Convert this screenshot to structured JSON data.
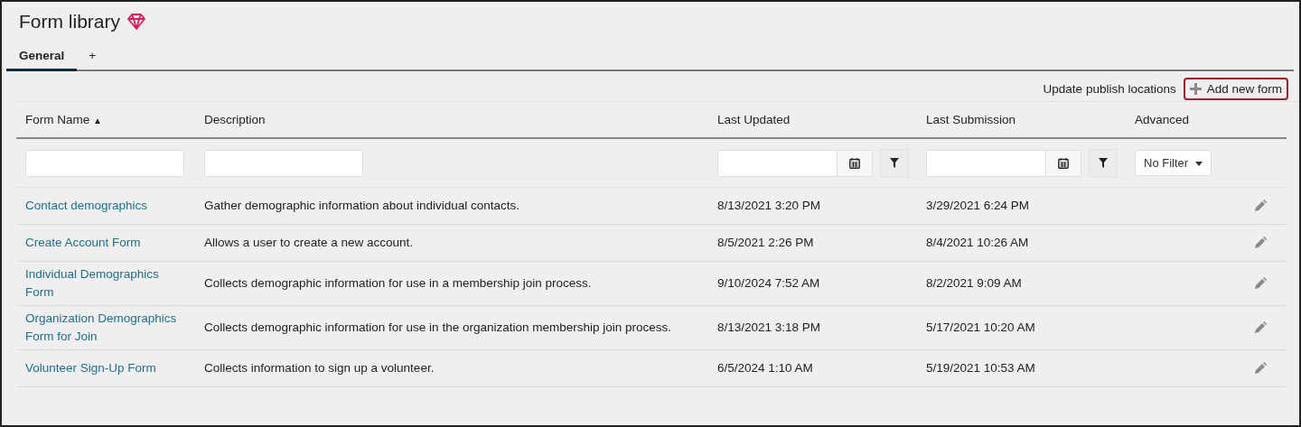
{
  "title": "Form library",
  "tabs": [
    {
      "label": "General",
      "selected": true
    },
    {
      "label": "+",
      "selected": false
    }
  ],
  "actions": {
    "link": "Update publish locations",
    "button": "Add new form"
  },
  "table": {
    "columns": [
      {
        "label": "Form Name",
        "sort": "▲"
      },
      {
        "label": "Description"
      },
      {
        "label": "Last Updated"
      },
      {
        "label": "Last Submission"
      },
      {
        "label": "Advanced"
      }
    ],
    "filters": {
      "advanced": "No Filter"
    },
    "rows": [
      {
        "name": "Contact demographics",
        "description": "Gather demographic information about individual contacts.",
        "last_updated": "8/13/2021 3:20 PM",
        "last_submission": "3/29/2021 6:24 PM"
      },
      {
        "name": "Create Account Form",
        "description": "Allows a user to create a new account.",
        "last_updated": "8/5/2021 2:26 PM",
        "last_submission": "8/4/2021 10:26 AM"
      },
      {
        "name": "Individual Demographics Form",
        "description": "Collects demographic information for use in a membership join process.",
        "last_updated": "9/10/2024 7:52 AM",
        "last_submission": "8/2/2021 9:09 AM"
      },
      {
        "name": "Organization Demographics Form for Join",
        "description": "Collects demographic information for use in the organization membership join process.",
        "last_updated": "8/13/2021 3:18 PM",
        "last_submission": "5/17/2021 10:20 AM"
      },
      {
        "name": "Volunteer Sign-Up Form",
        "description": "Collects information to sign up a volunteer.",
        "last_updated": "6/5/2024 1:10 AM",
        "last_submission": "5/19/2021 10:53 AM"
      }
    ]
  }
}
